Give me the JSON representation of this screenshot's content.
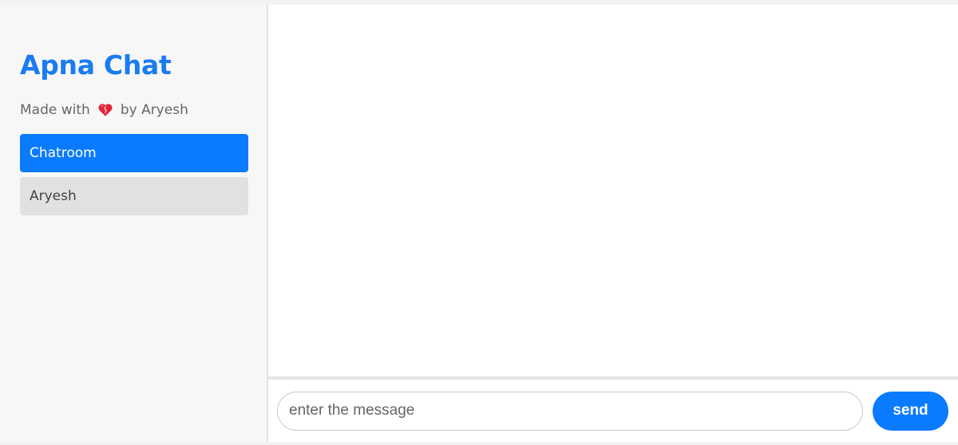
{
  "sidebar": {
    "title": "Apna Chat",
    "tagline_prefix": "Made with",
    "tagline_icon": "heart-icon",
    "tagline_suffix": "by Aryesh",
    "rooms": [
      {
        "label": "Chatroom",
        "active": true
      },
      {
        "label": "Aryesh",
        "active": false
      }
    ]
  },
  "composer": {
    "input_value": "",
    "input_placeholder": "enter the message",
    "send_label": "send"
  },
  "colors": {
    "accent": "#0a7bfd",
    "title": "#1a7cf0",
    "heart": "#e0243a"
  }
}
